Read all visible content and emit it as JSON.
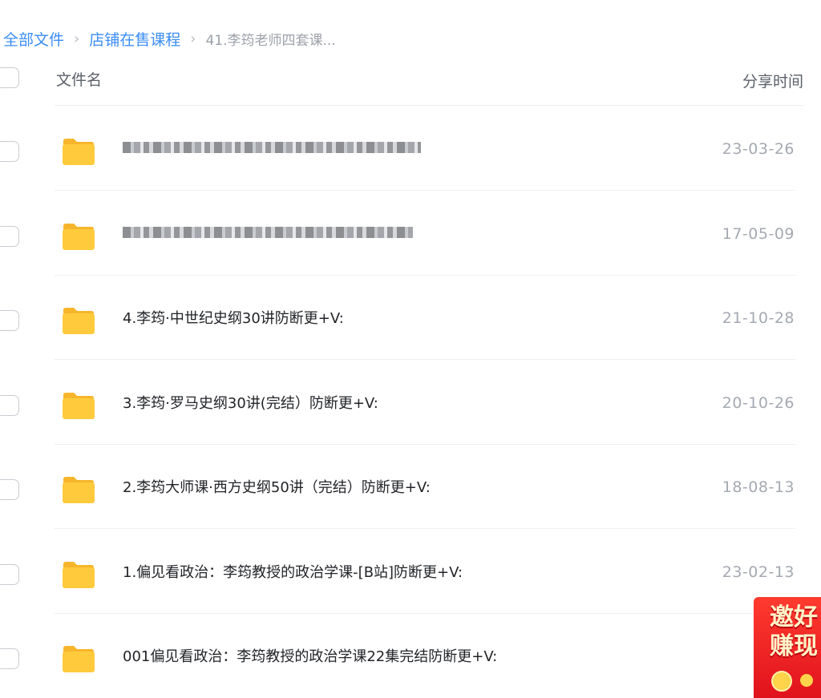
{
  "breadcrumb": {
    "items": [
      "全部文件",
      "店铺在售课程"
    ],
    "current": "41.李筠老师四套课..."
  },
  "header": {
    "name_label": "文件名",
    "time_label": "分享时间"
  },
  "files": [
    {
      "name": "",
      "time": "23-03-26"
    },
    {
      "name": "",
      "time": "17-05-09"
    },
    {
      "name": "4.李筠·中世纪史纲30讲防断更+V:",
      "time": "21-10-28"
    },
    {
      "name": "3.李筠·罗马史纲30讲(完结）防断更+V:",
      "time": "20-10-26"
    },
    {
      "name": "2.李筠大师课·西方史纲50讲（完结）防断更+V:",
      "time": "18-08-13"
    },
    {
      "name": "1.偏见看政治：李筠教授的政治学课-[B站]防断更+V:",
      "time": "23-02-13"
    },
    {
      "name": "001偏见看政治：李筠教授的政治学课22集完结防断更+V:",
      "time": "23-0"
    }
  ],
  "promo": {
    "line1": "邀好",
    "line2": "赚现"
  },
  "colors": {
    "link": "#3b8df5",
    "folder": "#ffcb3d",
    "promo_bg": "#ff3b2f"
  }
}
